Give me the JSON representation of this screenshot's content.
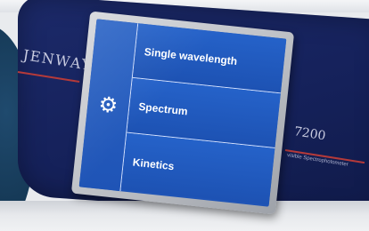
{
  "device": {
    "brand": "JENWAY",
    "model": "7200",
    "model_subtitle": "visible Spectrophotometer"
  },
  "screen": {
    "settings_icon": "gear-icon",
    "menu": [
      {
        "label": "Single wavelength"
      },
      {
        "label": "Spectrum"
      },
      {
        "label": "Kinetics"
      }
    ]
  },
  "colors": {
    "panel": "#15215a",
    "screen": "#1f54b6",
    "accent_stripe": "#b43a3a"
  }
}
